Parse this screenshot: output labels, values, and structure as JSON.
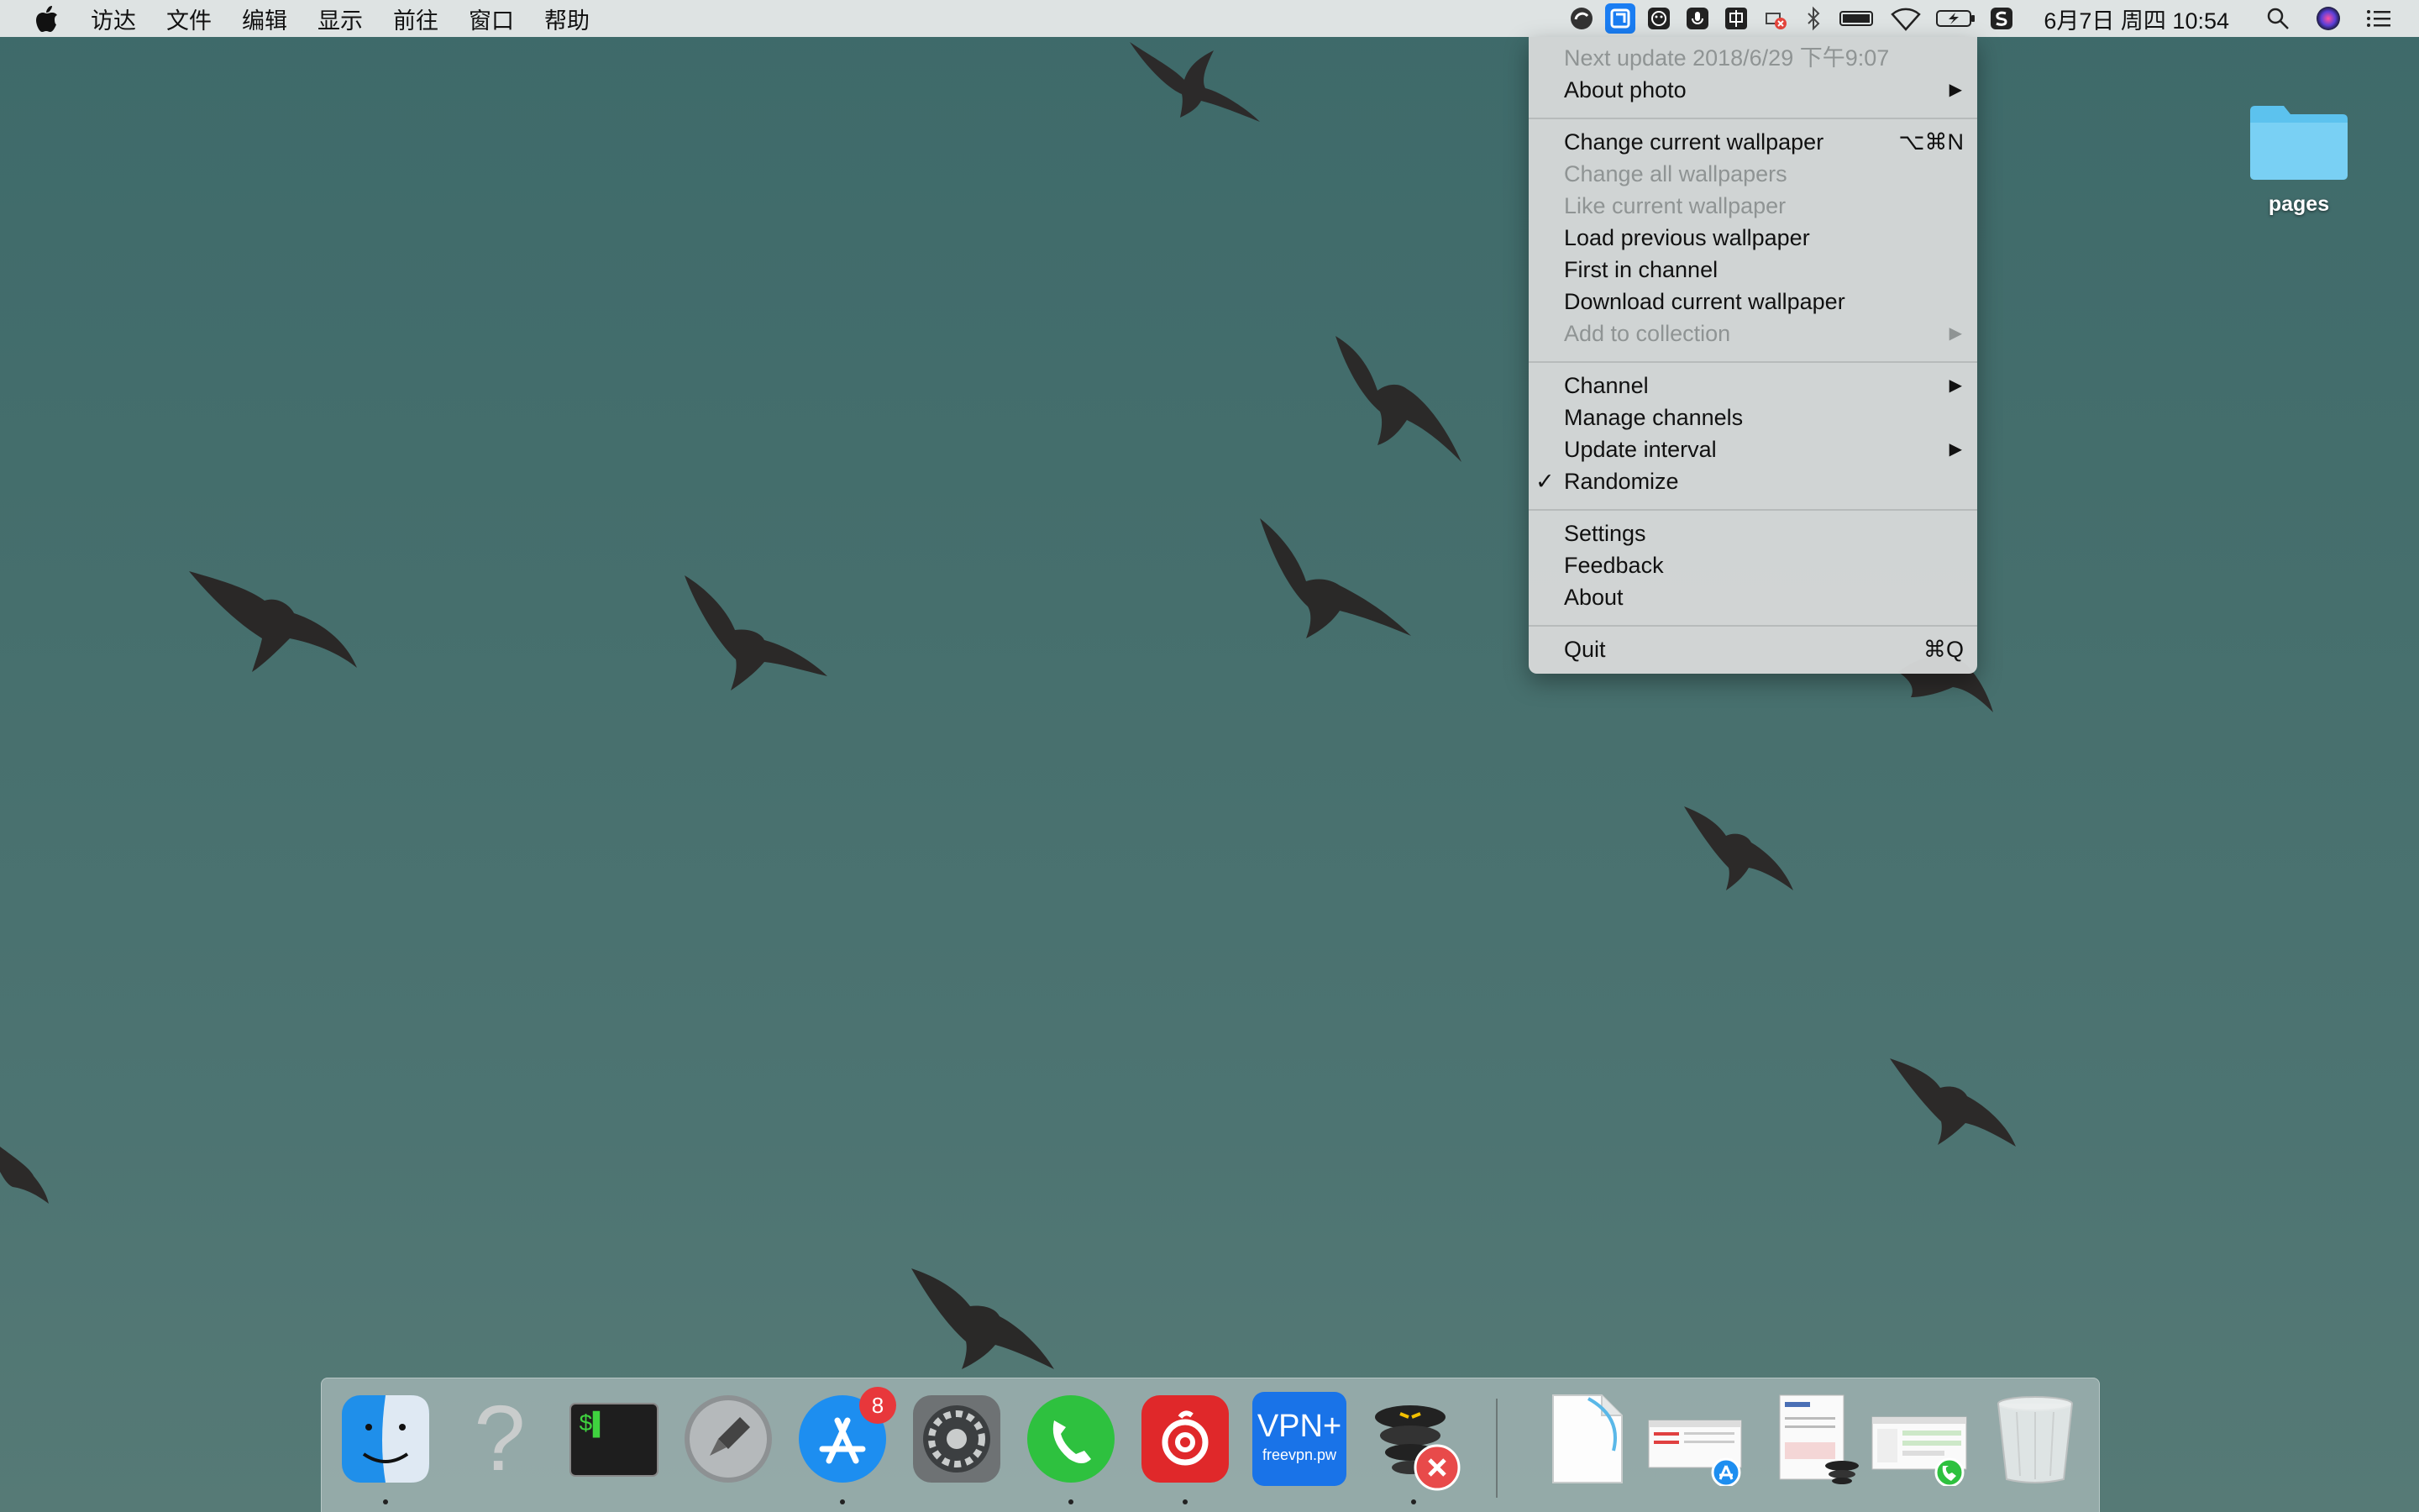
{
  "menubar": {
    "apple_icon": "apple-logo-icon",
    "items": [
      "访达",
      "文件",
      "编辑",
      "显示",
      "前往",
      "窗口",
      "帮助"
    ],
    "status_icons": [
      "activity-icon",
      "wallpaper-app-icon",
      "emoji-icon",
      "mic-icon",
      "input-method-icon",
      "blocked-icon",
      "bluetooth-icon",
      "battery-meter-icon",
      "wifi-icon",
      "battery-icon",
      "sogou-icon"
    ],
    "clock": "6月7日 周四 10:54",
    "search_icon": "search-icon",
    "siri_icon": "siri-icon",
    "notification_icon": "list-icon"
  },
  "dropdown": {
    "next_update": "Next update 2018/6/29 下午9:07",
    "about_photo": "About photo",
    "change_current": "Change current wallpaper",
    "change_current_shortcut": "⌥⌘N",
    "change_all": "Change all wallpapers",
    "like_current": "Like current wallpaper",
    "load_previous": "Load previous wallpaper",
    "first_in_channel": "First in channel",
    "download_current": "Download current wallpaper",
    "add_to_collection": "Add to collection",
    "channel": "Channel",
    "manage_channels": "Manage channels",
    "update_interval": "Update interval",
    "randomize": "Randomize",
    "randomize_check": "✓",
    "settings": "Settings",
    "feedback": "Feedback",
    "about": "About",
    "quit": "Quit",
    "quit_shortcut": "⌘Q",
    "arrow": "▶"
  },
  "desktop": {
    "folder_label": "pages"
  },
  "dock": {
    "apps": [
      "finder-icon",
      "unknown-app-icon",
      "terminal-icon",
      "launchpad-icon",
      "app-store-icon",
      "system-preferences-icon",
      "phone-app-icon",
      "netease-music-icon",
      "vpn-plus-icon",
      "vyprvpn-icon"
    ],
    "app_store_badge": "8",
    "vpn_title": "VPN+",
    "vpn_sub": "freevpn.pw",
    "question_mark": "?",
    "terminal_prompt": "$▌",
    "recent": [
      "document-icon",
      "app-store-window-icon",
      "browser-window-icon",
      "chat-window-icon",
      "trash-icon"
    ]
  }
}
